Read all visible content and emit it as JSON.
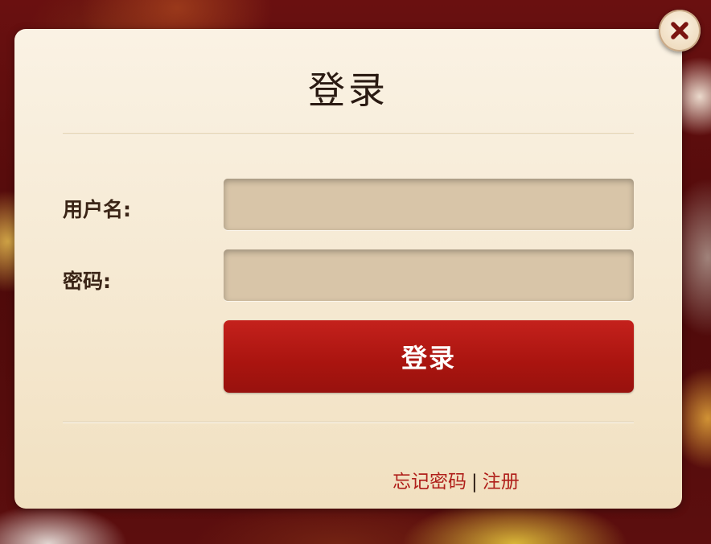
{
  "dialog": {
    "title": "登录",
    "username_label": "用户名:",
    "password_label": "密码:",
    "username_value": "",
    "password_value": "",
    "login_button": "登录",
    "forgot_password": "忘记密码",
    "separator": "|",
    "register": "注册",
    "close_icon": "close-icon"
  },
  "colors": {
    "button": "#b0170f",
    "link": "#b01f1a",
    "dialog_bg": "#f6ead5",
    "field_bg": "#d8c5a8"
  }
}
